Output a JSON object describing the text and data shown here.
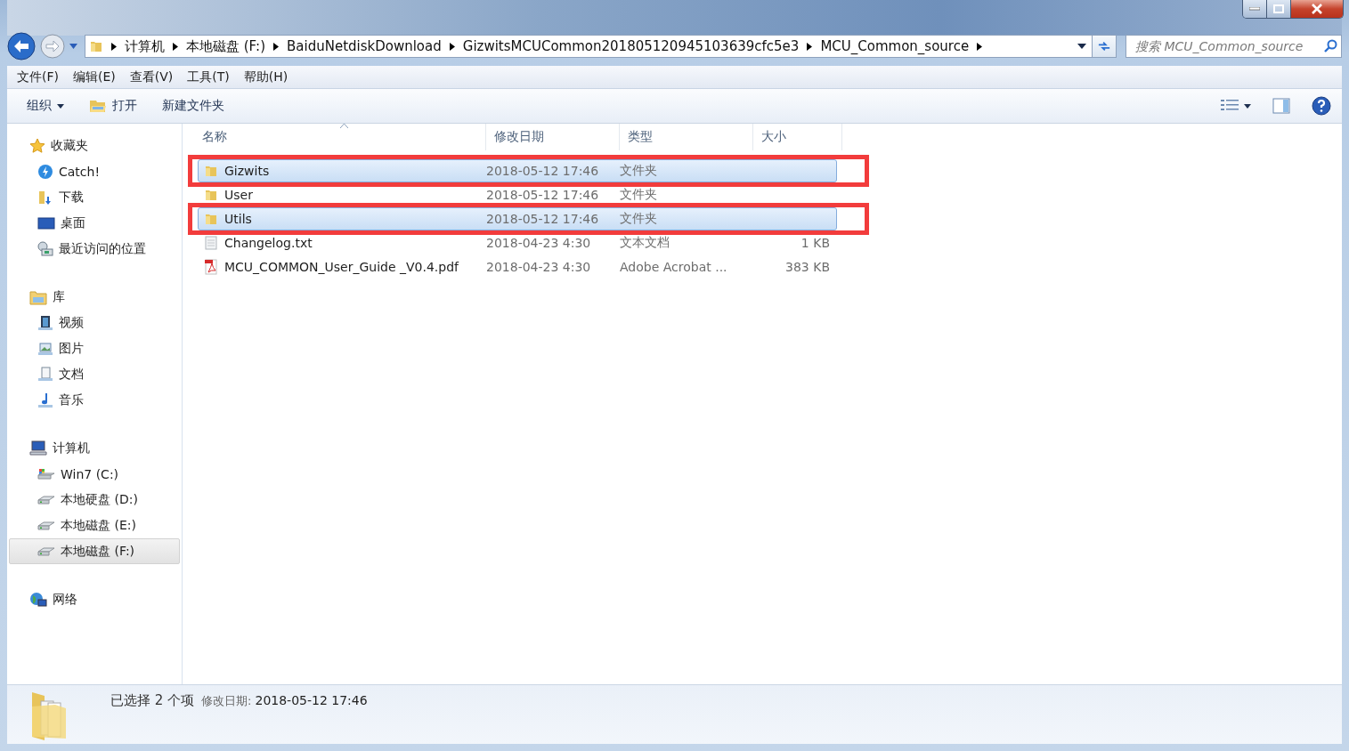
{
  "address_bar": {
    "breadcrumbs": [
      "计算机",
      "本地磁盘 (F:)",
      "BaiduNetdiskDownload",
      "GizwitsMCUCommon201805120945103639cfc5e3",
      "MCU_Common_source"
    ]
  },
  "search": {
    "placeholder": "搜索 MCU_Common_source"
  },
  "menu": [
    "文件(F)",
    "编辑(E)",
    "查看(V)",
    "工具(T)",
    "帮助(H)"
  ],
  "toolbar": [
    {
      "label": "组织",
      "kind": "dropdown"
    },
    {
      "label": "打开",
      "kind": "icon"
    },
    {
      "label": "新建文件夹",
      "kind": "plain"
    }
  ],
  "sidebar": [
    {
      "label": "收藏夹",
      "selected": false,
      "children": [
        {
          "label": "Catch!",
          "selected": false
        },
        {
          "label": "下载",
          "selected": false
        },
        {
          "label": "桌面",
          "selected": false
        },
        {
          "label": "最近访问的位置",
          "selected": false
        }
      ]
    },
    {
      "label": "库",
      "selected": false,
      "children": [
        {
          "label": "视频",
          "selected": false
        },
        {
          "label": "图片",
          "selected": false
        },
        {
          "label": "文档",
          "selected": false
        },
        {
          "label": "音乐",
          "selected": false
        }
      ]
    },
    {
      "label": "计算机",
      "selected": false,
      "children": [
        {
          "label": "Win7 (C:)",
          "selected": false
        },
        {
          "label": "本地硬盘 (D:)",
          "selected": false
        },
        {
          "label": "本地磁盘 (E:)",
          "selected": false
        },
        {
          "label": "本地磁盘 (F:)",
          "selected": true
        }
      ]
    },
    {
      "label": "网络",
      "selected": false
    }
  ],
  "table": {
    "columns": [
      {
        "label": "名称",
        "sorted": true
      },
      {
        "label": "修改日期",
        "sorted": false
      },
      {
        "label": "类型",
        "sorted": false
      },
      {
        "label": "大小",
        "sorted": false
      }
    ],
    "rows": [
      {
        "kind": "folder",
        "name": "Gizwits",
        "date": "2018-05-12 17:46",
        "type": "文件夹",
        "selected": true,
        "outlined": true
      },
      {
        "kind": "folder",
        "name": "User",
        "date": "2018-05-12 17:46",
        "type": "文件夹",
        "selected": false,
        "outlined": false
      },
      {
        "kind": "folder",
        "name": "Utils",
        "date": "2018-05-12 17:46",
        "type": "文件夹",
        "selected": true,
        "outlined": true
      },
      {
        "kind": "text",
        "name": "Changelog.txt",
        "date": "2018-04-23 4:30",
        "type": "文本文档",
        "size": "1 KB",
        "selected": false,
        "outlined": false
      },
      {
        "kind": "pdf",
        "name": "MCU_COMMON_User_Guide _V0.4.pdf",
        "date": "2018-04-23 4:30",
        "type": "Adobe Acrobat ...",
        "size": "383 KB",
        "selected": false,
        "outlined": false
      }
    ]
  },
  "status_bar": {
    "summary": "已选择 2 个项",
    "detail_label": "修改日期:",
    "detail_value": "2018-05-12 17:46"
  }
}
